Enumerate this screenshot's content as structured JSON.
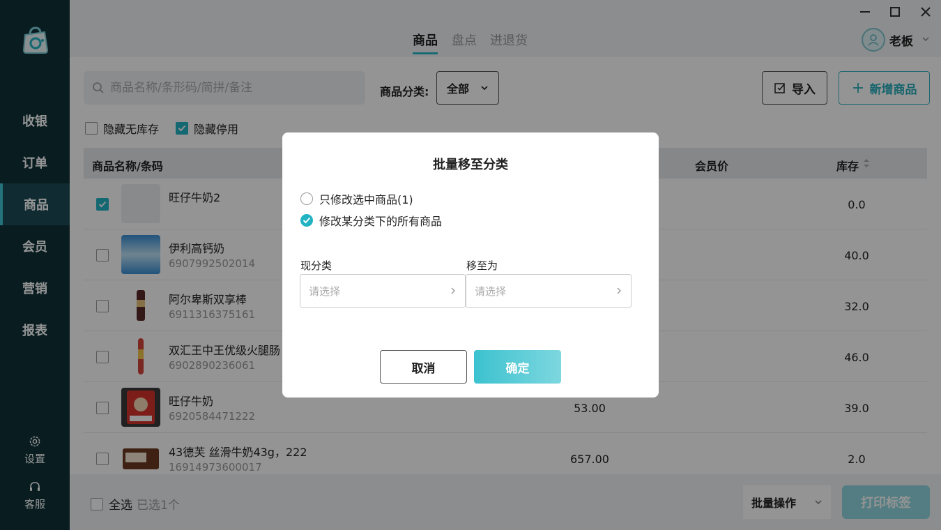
{
  "sidebar": {
    "items": [
      {
        "label": "收银"
      },
      {
        "label": "订单"
      },
      {
        "label": "商品"
      },
      {
        "label": "会员"
      },
      {
        "label": "营销"
      },
      {
        "label": "报表"
      }
    ],
    "settings_label": "设置",
    "service_label": "客服"
  },
  "topbar": {
    "tabs": [
      {
        "label": "商品"
      },
      {
        "label": "盘点"
      },
      {
        "label": "进退货"
      }
    ],
    "user_name": "老板"
  },
  "toolbar": {
    "search_placeholder": "商品名称/条形码/简拼/备注",
    "category_label": "商品分类:",
    "category_value": "全部",
    "import_label": "导入",
    "add_label": "新增商品"
  },
  "filters": {
    "hide_no_stock": "隐藏无库存",
    "hide_disabled": "隐藏停用"
  },
  "table": {
    "headers": {
      "name": "商品名称/条码",
      "member_price": "会员价",
      "stock": "库存"
    },
    "rows": [
      {
        "name": "旺仔牛奶2",
        "code": "",
        "price": "",
        "stock": "0.0"
      },
      {
        "name": "伊利高钙奶",
        "code": "6907992502014",
        "price": "",
        "stock": "40.0"
      },
      {
        "name": "阿尔卑斯双享棒",
        "code": "6911316375161",
        "price": "",
        "stock": "32.0"
      },
      {
        "name": "双汇王中王优级火腿肠",
        "code": "6902890236061",
        "price": "",
        "stock": "46.0"
      },
      {
        "name": "旺仔牛奶",
        "code": "6920584471222",
        "price": "53.00",
        "stock": "39.0"
      },
      {
        "name": "43德芙 丝滑牛奶43g，222",
        "code": "16914973600017",
        "price": "657.00",
        "stock": "2.0"
      }
    ]
  },
  "footer": {
    "select_all": "全选",
    "selected_count": "已选1个",
    "batch_label": "批量操作",
    "print_label": "打印标签"
  },
  "modal": {
    "title": "批量移至分类",
    "option_selected": "只修改选中商品(1)",
    "option_category": "修改某分类下的所有商品",
    "current_label": "现分类",
    "target_label": "移至为",
    "current_placeholder": "请选择",
    "target_placeholder": "请选择",
    "cancel_label": "取消",
    "ok_label": "确定"
  },
  "colors": {
    "sidebar_bg": "#10333a",
    "accent": "#21b3c3"
  }
}
